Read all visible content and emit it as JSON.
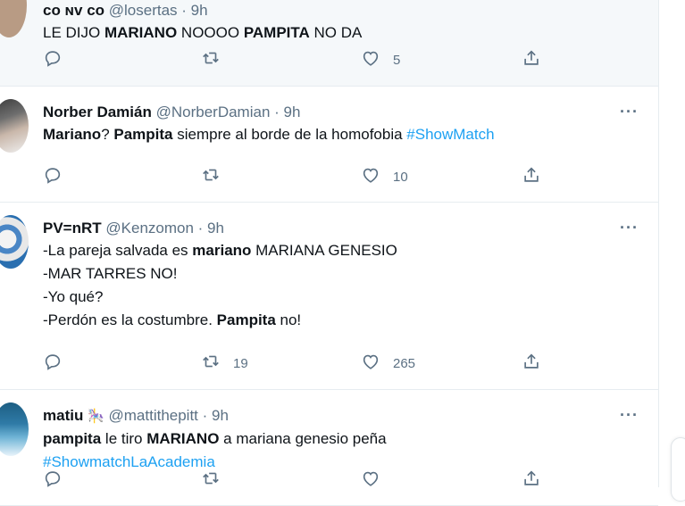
{
  "tweets": [
    {
      "name": "ᴄᴏ ɴᴠ ᴄᴏ",
      "handle": "@losertas",
      "time": "9h",
      "body": [
        [
          {
            "t": "LE DIJO ",
            "s": "n"
          },
          {
            "t": "MARIANO",
            "s": "b"
          },
          {
            "t": " NOOOO ",
            "s": "n"
          },
          {
            "t": "PAMPITA",
            "s": "b"
          },
          {
            "t": " NO DA",
            "s": "n"
          }
        ]
      ],
      "reply_count": "",
      "retweet_count": "",
      "like_count": "5"
    },
    {
      "name": "Norber Damián",
      "handle": "@NorberDamian",
      "time": "9h",
      "body": [
        [
          {
            "t": "Mariano",
            "s": "b"
          },
          {
            "t": "? ",
            "s": "n"
          },
          {
            "t": "Pampita",
            "s": "b"
          },
          {
            "t": " siempre al borde de la homofobia ",
            "s": "n"
          },
          {
            "t": "#ShowMatch",
            "s": "h"
          }
        ]
      ],
      "reply_count": "",
      "retweet_count": "",
      "like_count": "10"
    },
    {
      "name": "PV=nRT",
      "handle": "@Kenzomon",
      "time": "9h",
      "body": [
        [
          {
            "t": "-La pareja salvada es ",
            "s": "n"
          },
          {
            "t": "mariano",
            "s": "b"
          },
          {
            "t": " MARIANA GENESIO",
            "s": "n"
          }
        ],
        [
          {
            "t": "-MAR TARRES NO!",
            "s": "n"
          }
        ],
        [
          {
            "t": "-Yo qué?",
            "s": "n"
          }
        ],
        [
          {
            "t": "-Perdón es la costumbre. ",
            "s": "n"
          },
          {
            "t": "Pampita",
            "s": "b"
          },
          {
            "t": " no!",
            "s": "n"
          }
        ]
      ],
      "reply_count": "",
      "retweet_count": "19",
      "like_count": "265"
    },
    {
      "name": "matiu",
      "name_emoji": "🎠",
      "handle": "@mattithepitt",
      "time": "9h",
      "body": [
        [
          {
            "t": "pampita",
            "s": "b"
          },
          {
            "t": " le tiro ",
            "s": "n"
          },
          {
            "t": "MARIANO",
            "s": "b"
          },
          {
            "t": " a mariana genesio peña",
            "s": "n"
          }
        ],
        [
          {
            "t": "#ShowmatchLaAcademia",
            "s": "h"
          }
        ]
      ],
      "reply_count": "",
      "retweet_count": "",
      "like_count": ""
    }
  ],
  "separator": " · ",
  "more_label": "···",
  "icons": {
    "reply": "reply-icon",
    "retweet": "retweet-icon",
    "like": "heart-icon",
    "share": "share-icon",
    "more": "more-icon"
  },
  "colors": {
    "hashtag": "#1da1f2",
    "secondary": "#5b7083",
    "divider": "#e6ecf0"
  }
}
